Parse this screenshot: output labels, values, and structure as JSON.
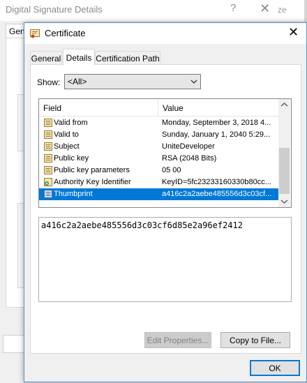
{
  "background_window": {
    "title": "Digital Signature Details",
    "help_glyph": "?",
    "close_glyph": "✕",
    "partial_text": "ze",
    "tab_partial": "Gen"
  },
  "certificate_window": {
    "title": "Certificate",
    "close_glyph": "✕",
    "tabs": [
      {
        "label": "General"
      },
      {
        "label": "Details"
      },
      {
        "label": "Certification Path"
      }
    ],
    "show": {
      "label": "Show:",
      "selected": "<All>"
    },
    "list": {
      "columns": [
        "Field",
        "Value"
      ],
      "rows": [
        {
          "icon": "certificate-field-icon",
          "field": "Valid from",
          "value": "Monday, September 3, 2018 4..."
        },
        {
          "icon": "certificate-field-icon",
          "field": "Valid to",
          "value": "Sunday, January 1, 2040 5:29..."
        },
        {
          "icon": "certificate-field-icon",
          "field": "Subject",
          "value": "UniteDeveloper"
        },
        {
          "icon": "certificate-field-icon",
          "field": "Public key",
          "value": "RSA (2048 Bits)"
        },
        {
          "icon": "certificate-field-icon",
          "field": "Public key parameters",
          "value": "05 00"
        },
        {
          "icon": "extension-field-icon",
          "field": "Authority Key Identifier",
          "value": "KeyID=5fc23233160330b80cc..."
        },
        {
          "icon": "property-field-icon",
          "field": "Thumbprint",
          "value": "a416c2a2aebe485556d3c03cf..."
        }
      ],
      "selected_index": 6
    },
    "detail_value": "a416c2a2aebe485556d3c03cf6d85e2a96ef2412",
    "buttons": {
      "edit_properties": "Edit Properties...",
      "copy_to_file": "Copy to File...",
      "ok": "OK"
    },
    "colors": {
      "selection": "#0078d7",
      "window_border": "#5a8fc8"
    }
  }
}
